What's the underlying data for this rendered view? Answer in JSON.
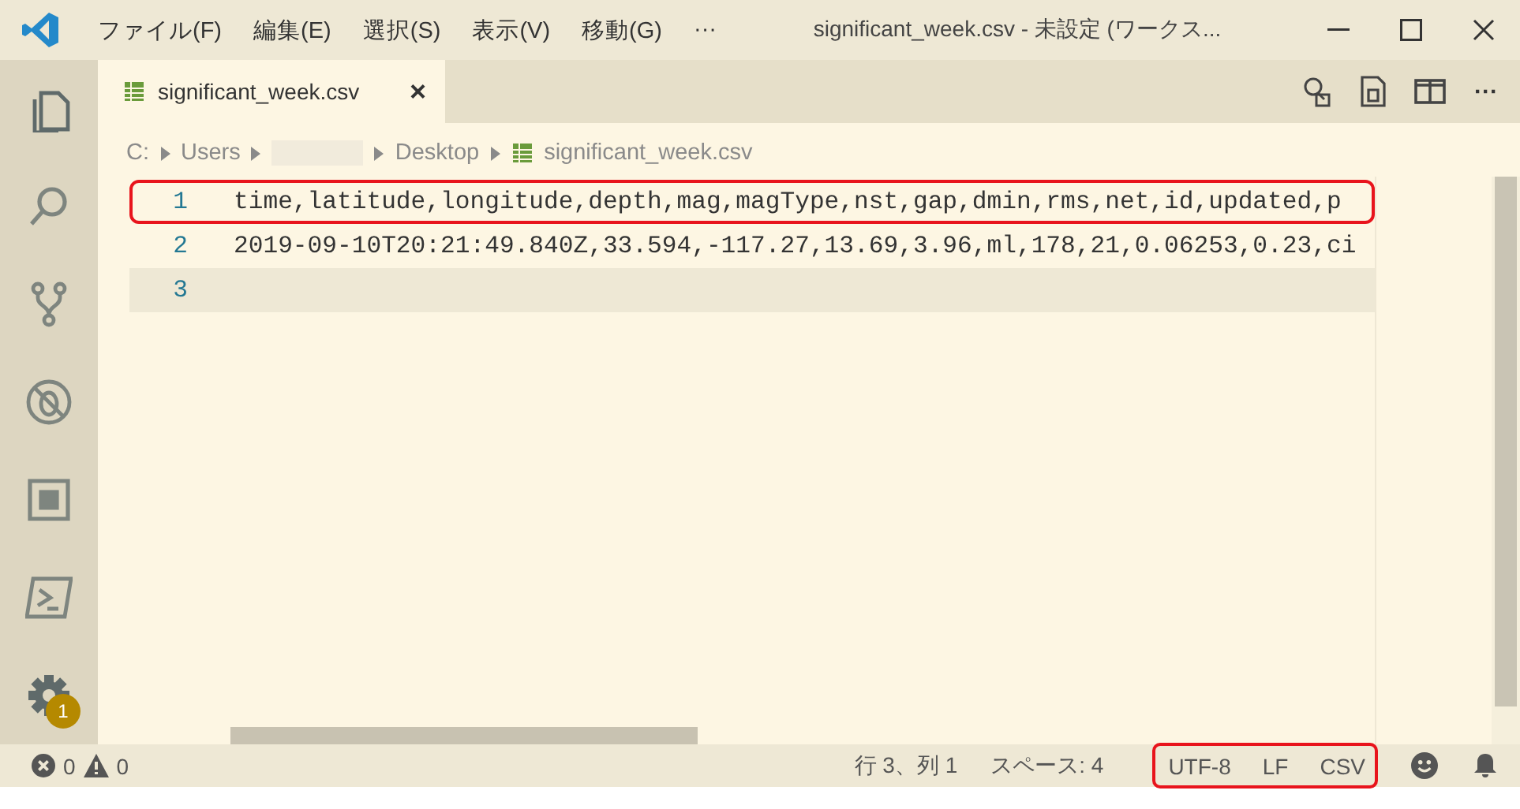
{
  "title_bar": {
    "menus": [
      "ファイル(F)",
      "編集(E)",
      "選択(S)",
      "表示(V)",
      "移動(G)"
    ],
    "more": "···",
    "title": "significant_week.csv - 未設定 (ワークス..."
  },
  "activity_bar": {
    "items": [
      {
        "kind": "files",
        "selected": true
      },
      {
        "kind": "search",
        "selected": false
      },
      {
        "kind": "scm",
        "selected": false
      },
      {
        "kind": "debug",
        "selected": false
      },
      {
        "kind": "extensions",
        "selected": false
      },
      {
        "kind": "terminal",
        "selected": false
      }
    ],
    "settings_badge": "1"
  },
  "tabs": [
    {
      "label": "significant_week.csv",
      "selected": true,
      "close": "×"
    }
  ],
  "tab_actions": {
    "more": "···"
  },
  "breadcrumb": [
    {
      "kind": "text",
      "label": "C:"
    },
    {
      "kind": "text",
      "label": "Users"
    },
    {
      "kind": "redacted"
    },
    {
      "kind": "text",
      "label": "Desktop"
    },
    {
      "kind": "file",
      "label": "significant_week.csv"
    }
  ],
  "editor": {
    "lines": [
      {
        "number": "1",
        "text": "time,latitude,longitude,depth,mag,magType,nst,gap,dmin,rms,net,id,updated,p",
        "current": false,
        "highlighted": true
      },
      {
        "number": "2",
        "text": "2019-09-10T20:21:49.840Z,33.594,-117.27,13.69,3.96,ml,178,21,0.06253,0.23,ci",
        "current": false,
        "highlighted": false
      },
      {
        "number": "3",
        "current": true,
        "highlighted": false
      }
    ]
  },
  "status_bar": {
    "errors": "0",
    "warnings": "0",
    "right_items": [
      {
        "label": "行 3、列 1",
        "highlighted": false
      },
      {
        "label": "スペース: 4",
        "highlighted": false
      },
      {
        "label": "UTF-8",
        "highlighted": true
      },
      {
        "label": "LF",
        "highlighted": true
      },
      {
        "label": "CSV",
        "highlighted": true
      }
    ]
  }
}
